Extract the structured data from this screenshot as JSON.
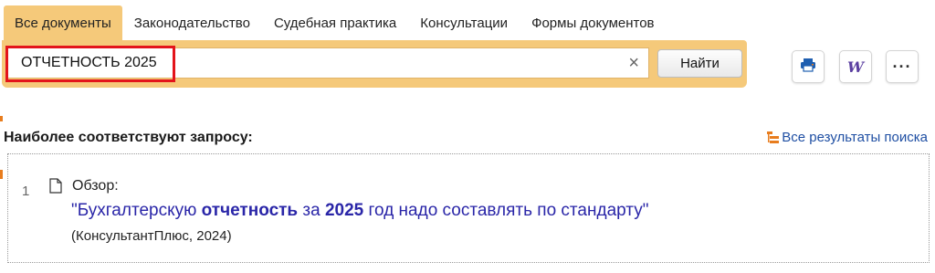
{
  "tabs": [
    {
      "label": "Все документы",
      "active": true
    },
    {
      "label": "Законодательство",
      "active": false
    },
    {
      "label": "Судебная практика",
      "active": false
    },
    {
      "label": "Консультации",
      "active": false
    },
    {
      "label": "Формы документов",
      "active": false
    }
  ],
  "search": {
    "query": "ОТЧЕТНОСТЬ 2025",
    "clear_icon": "×",
    "find_label": "Найти"
  },
  "toolbar": {
    "print_icon": "print-icon",
    "word_icon": "word-icon",
    "word_glyph": "W",
    "more_icon": "more-icon",
    "more_glyph": "···"
  },
  "results_section": {
    "title": "Наиболее соответствуют запросу:",
    "all_results_label": "Все результаты поиска",
    "all_results_icon": "results-tree-icon"
  },
  "results": [
    {
      "number": "1",
      "type": "Обзор:",
      "title_parts": [
        {
          "text": "\"Бухгалтерскую ",
          "bold": false
        },
        {
          "text": "отчетность",
          "bold": true
        },
        {
          "text": " за ",
          "bold": false
        },
        {
          "text": "2025",
          "bold": true
        },
        {
          "text": " год надо составлять по стандарту\"",
          "bold": false
        }
      ],
      "source": "(КонсультантПлюс, 2024)"
    }
  ],
  "colors": {
    "accent": "#f5c97a",
    "highlight": "#e3141b",
    "link": "#2a26a8",
    "marker": "#e87d1e"
  }
}
